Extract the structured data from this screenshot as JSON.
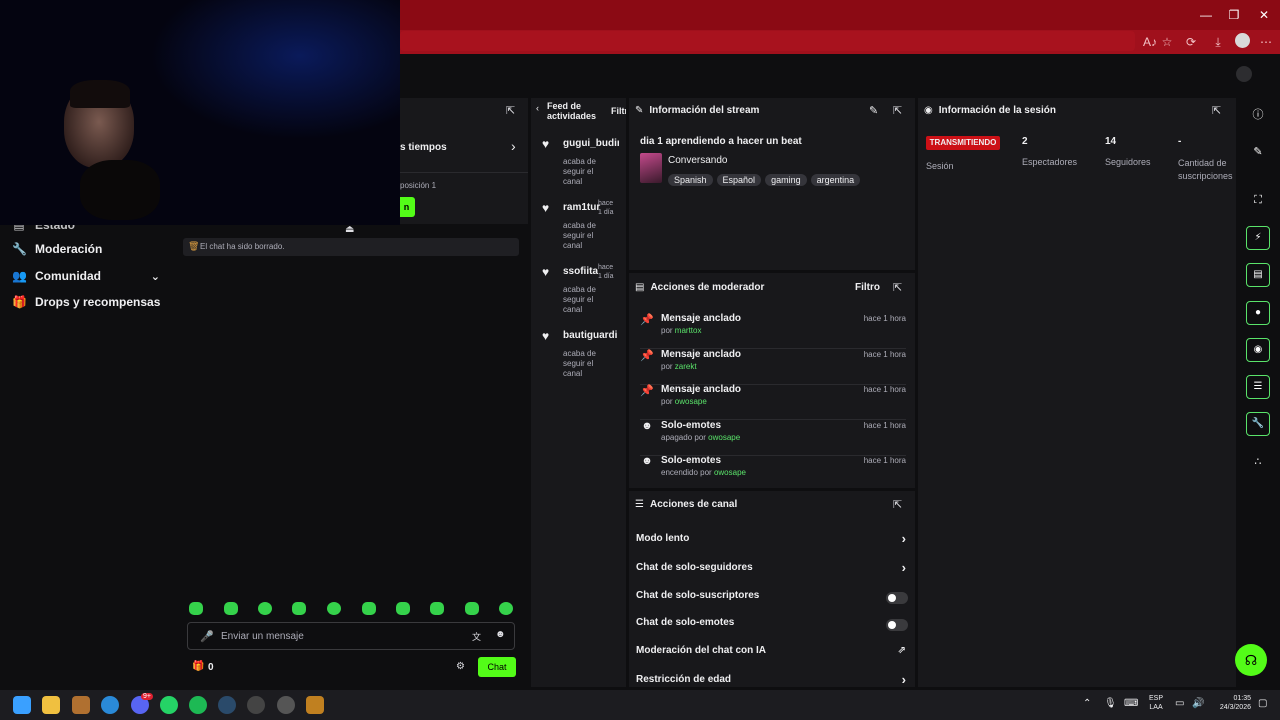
{
  "browser": {
    "window_controls": [
      "—",
      "❐",
      "✕"
    ],
    "addr_icons": [
      "A♪",
      "☆",
      "⟳",
      "⤓",
      "⋯"
    ]
  },
  "sidebar": {
    "partial_item": "Estado",
    "items": [
      {
        "label": "Moderación",
        "icon": "wrench-icon"
      },
      {
        "label": "Comunidad",
        "icon": "people-icon",
        "expandable": true
      },
      {
        "label": "Drops y recompensas",
        "icon": "gift-icon"
      }
    ]
  },
  "chat": {
    "partial_header": "s tiempos",
    "partial_position": "posición 1",
    "partial_btn": "n",
    "cleared_msg": "El chat ha sido borrado.",
    "input_placeholder": "Enviar un mensaje",
    "points": "0",
    "send_label": "Chat"
  },
  "feed": {
    "title_line1": "Feed de",
    "title_line2": "actividades",
    "filter": "Filtr",
    "items": [
      {
        "name": "gugui_budir",
        "sub": [
          "acaba de",
          "seguir el",
          "canal"
        ],
        "time": []
      },
      {
        "name": "ram1tur",
        "sub": [
          "acaba de",
          "seguir el",
          "canal"
        ],
        "time": [
          "hace",
          "1 día"
        ]
      },
      {
        "name": "ssofiita",
        "sub": [
          "acaba de",
          "seguir el",
          "canal"
        ],
        "time": [
          "hace",
          "1 día"
        ]
      },
      {
        "name": "bautiguardi",
        "sub": [
          "acaba de",
          "seguir el",
          "canal"
        ],
        "time": []
      }
    ]
  },
  "stream_info": {
    "title": "Información del stream",
    "stream_title": "dia 1 aprendiendo a hacer un beat",
    "category": "Conversando",
    "tags": [
      "Spanish",
      "Español",
      "gaming",
      "argentina"
    ]
  },
  "mod_actions": {
    "title": "Acciones de moderador",
    "filter": "Filtro",
    "items": [
      {
        "action": "Mensaje anclado",
        "prefix": "por",
        "user": "marttox",
        "time": "hace 1 hora",
        "icon": "pin-icon"
      },
      {
        "action": "Mensaje anclado",
        "prefix": "por",
        "user": "zarekt",
        "time": "hace 1 hora",
        "icon": "pin-icon"
      },
      {
        "action": "Mensaje anclado",
        "prefix": "por",
        "user": "owosape",
        "time": "hace 1 hora",
        "icon": "pin-icon"
      },
      {
        "action": "Solo-emotes",
        "prefix": "apagado por",
        "user": "owosape",
        "time": "hace 1 hora",
        "icon": "smile-icon"
      },
      {
        "action": "Solo-emotes",
        "prefix": "encendido por",
        "user": "owosape",
        "time": "hace 1 hora",
        "icon": "smile-icon"
      }
    ]
  },
  "channel_actions": {
    "title": "Acciones de canal",
    "items": [
      {
        "label": "Modo lento",
        "control": "chevron"
      },
      {
        "label": "Chat de solo-seguidores",
        "control": "chevron"
      },
      {
        "label": "Chat de solo-suscriptores",
        "control": "toggle"
      },
      {
        "label": "Chat de solo-emotes",
        "control": "toggle"
      },
      {
        "label": "Moderación del chat con IA",
        "control": "external"
      },
      {
        "label": "Restricción de edad",
        "control": "chevron"
      }
    ]
  },
  "session_info": {
    "title": "Información de la sesión",
    "live_badge": "TRANSMITIENDO",
    "session_label": "Sesión",
    "viewers_value": "2",
    "viewers_label": "Espectadores",
    "followers_value": "14",
    "followers_label": "Seguidores",
    "subs_value": "-",
    "subs_label_1": "Cantidad de",
    "subs_label_2": "suscripciones"
  },
  "taskbar": {
    "lang_1": "ESP",
    "lang_2": "LAA",
    "time": "01:35",
    "date": "24/3/2026",
    "badge": "9+"
  },
  "colors": {
    "accent": "#53fc18",
    "live_badge": "#cc1016",
    "browser_frame": "#8b0a14"
  }
}
